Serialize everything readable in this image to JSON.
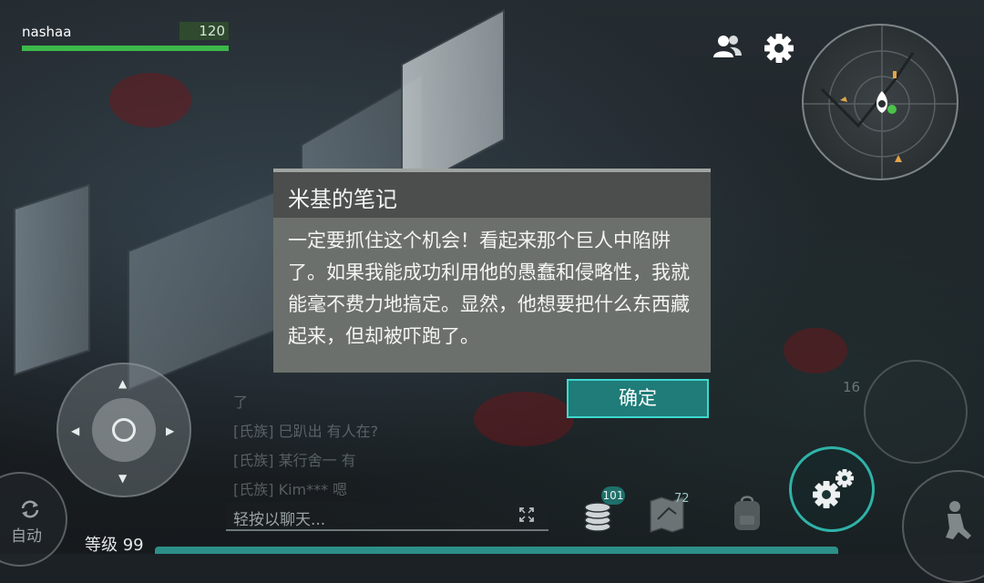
{
  "player": {
    "name": "nashaa",
    "health": "120",
    "health_fraction": 1.0
  },
  "top_icons": [
    "players-icon",
    "gear-icon"
  ],
  "dialog": {
    "title": "米基的笔记",
    "text": "一定要抓住这个机会！看起来那个巨人中陷阱了。如果我能成功利用他的愚蠢和侵略性，我就能毫不费力地搞定。显然，他想要把什么东西藏起来，但却被吓跑了。",
    "confirm_label": "确定"
  },
  "controls": {
    "auto_label": "自动",
    "level_label": "等级 99"
  },
  "chat": {
    "lines": [
      "了",
      "[氏族] 巳趴出 有人在?",
      "[氏族] 某行舍一 有",
      "[氏族] Kim*** 嗯"
    ],
    "placeholder": "轻按以聊天..."
  },
  "inventory": {
    "coins_count": "101",
    "map_count": "72",
    "ammo_count": "16"
  },
  "colors": {
    "accent": "#2fb3a8",
    "health": "#3cb94a",
    "dialog_header": "#4b4e4c",
    "dialog_body": "#6c706c"
  }
}
